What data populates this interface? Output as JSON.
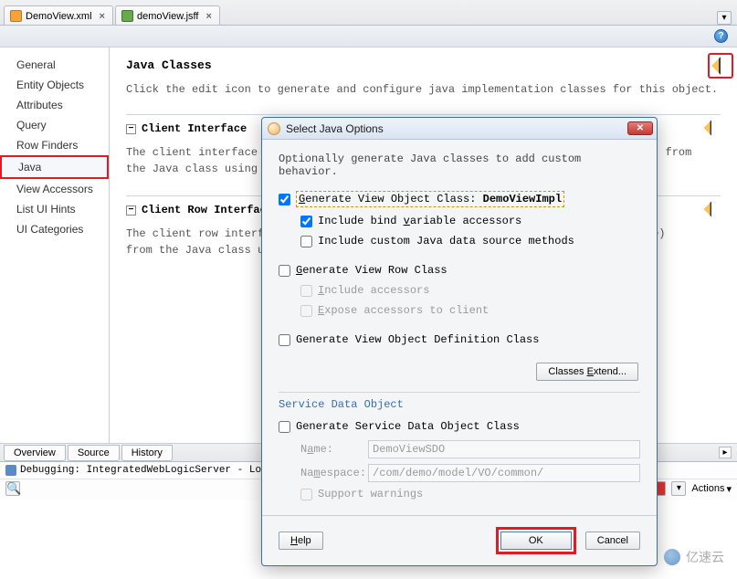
{
  "tabs": [
    {
      "label": "DemoView.xml",
      "icon": "xml"
    },
    {
      "label": "demoView.jsff",
      "icon": "jsf"
    }
  ],
  "sidebar": {
    "items": [
      {
        "label": "General"
      },
      {
        "label": "Entity Objects"
      },
      {
        "label": "Attributes"
      },
      {
        "label": "Query"
      },
      {
        "label": "Row Finders"
      },
      {
        "label": "Java",
        "selected": true
      },
      {
        "label": "View Accessors"
      },
      {
        "label": "List UI Hints"
      },
      {
        "label": "UI Categories"
      }
    ]
  },
  "main": {
    "title": "Java Classes",
    "desc": "Click the edit icon to generate and configure java implementation classes for this object.",
    "sections": [
      {
        "title": "Client Interface",
        "body": "The client interface contains the view object methods (add using Edit icon above) from the Java class using this object."
      },
      {
        "title": "Client Row Interface",
        "body": "The client row interface contains the view row methods (add using Edit icon above) from the Java class using this object."
      }
    ]
  },
  "bottom_tabs": [
    "Overview",
    "Source",
    "History"
  ],
  "log": {
    "title": "Debugging: IntegratedWebLogicServer - Log",
    "actions_label": "Actions"
  },
  "dialog": {
    "title": "Select Java Options",
    "intro": "Optionally generate Java classes to add custom behavior.",
    "gen_vo_label_prefix": "Generate View Object Class: ",
    "gen_vo_class": "DemoViewImpl",
    "include_bind": "Include bind variable accessors",
    "include_custom": "Include custom Java data source methods",
    "gen_row": "Generate View Row Class",
    "include_acc": "Include accessors",
    "expose_acc": "Expose accessors to client",
    "gen_def": "Generate View Object Definition Class",
    "classes_extend": "Classes Extend...",
    "sdo_head": "Service Data Object",
    "gen_sdo": "Generate Service Data Object Class",
    "name_label": "Name:",
    "name_value": "DemoViewSDO",
    "ns_label": "Namespace:",
    "ns_value": "/com/demo/model/VO/common/",
    "supp_warn": "Support warnings",
    "help": "Help",
    "ok": "OK",
    "cancel": "Cancel"
  },
  "watermark": "亿速云"
}
